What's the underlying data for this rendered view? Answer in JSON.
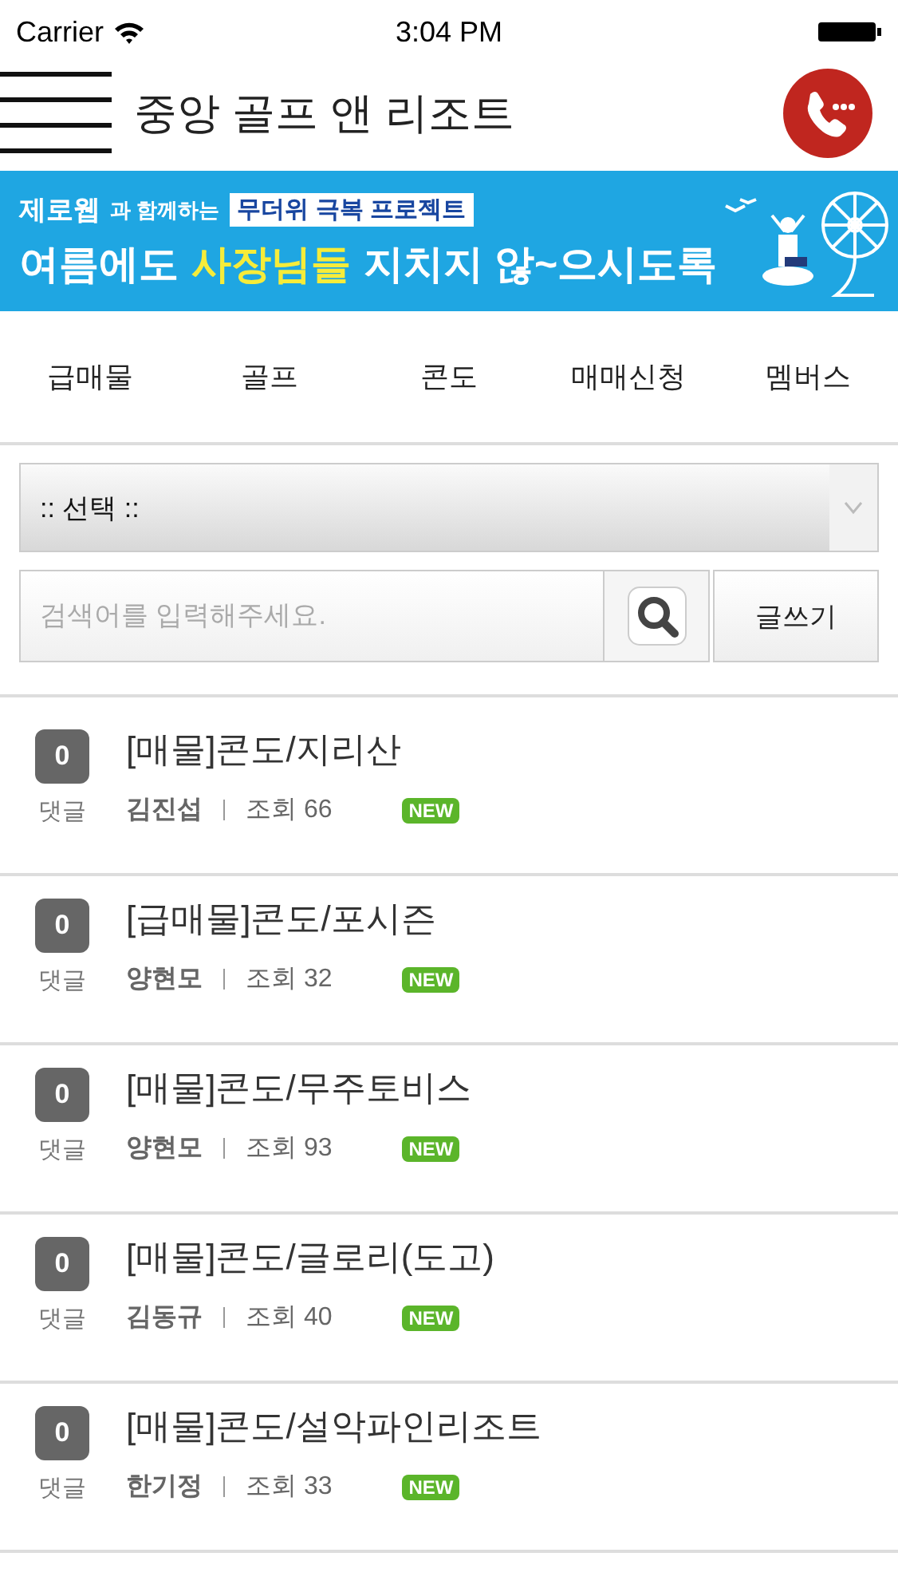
{
  "status_bar": {
    "carrier": "Carrier",
    "time": "3:04 PM"
  },
  "header": {
    "title": "중앙 골프 앤 리조트"
  },
  "banner": {
    "brand": "제로웹",
    "brand_suffix": "과 함께하는",
    "tag": "무더위 극복 프로젝트",
    "headline_1": "여름에도",
    "headline_highlight": "사장님들",
    "headline_2": "지치지 않~으시도록"
  },
  "nav": {
    "items": [
      "급매물",
      "골프",
      "콘도",
      "매매신청",
      "멤버스"
    ]
  },
  "filter": {
    "select_value": ":: 선택 ::",
    "search_placeholder": "검색어를 입력해주세요.",
    "write_button": "글쓰기"
  },
  "posts": [
    {
      "comments": "0",
      "comments_label": "댓글",
      "title": "[매물]콘도/지리산",
      "author": "김진섭",
      "views": "조회 66",
      "badge": "NEW"
    },
    {
      "comments": "0",
      "comments_label": "댓글",
      "title": "[급매물]콘도/포시즌",
      "author": "양현모",
      "views": "조회 32",
      "badge": "NEW"
    },
    {
      "comments": "0",
      "comments_label": "댓글",
      "title": "[매물]콘도/무주토비스",
      "author": "양현모",
      "views": "조회 93",
      "badge": "NEW"
    },
    {
      "comments": "0",
      "comments_label": "댓글",
      "title": "[매물]콘도/글로리(도고)",
      "author": "김동규",
      "views": "조회 40",
      "badge": "NEW"
    },
    {
      "comments": "0",
      "comments_label": "댓글",
      "title": "[매물]콘도/설악파인리조트",
      "author": "한기정",
      "views": "조회 33",
      "badge": "NEW"
    }
  ]
}
